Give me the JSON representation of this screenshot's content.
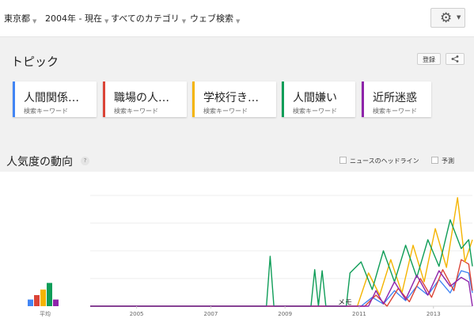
{
  "filters": [
    {
      "label": "東京都"
    },
    {
      "label": "2004年 - 現在"
    },
    {
      "label": "すべてのカテゴリ"
    },
    {
      "label": "ウェブ検索"
    }
  ],
  "icons": {
    "settings": "gear-icon",
    "share": "share-icon",
    "help": "help-icon"
  },
  "topics": {
    "title": "トピック",
    "register_label": "登録",
    "items": [
      {
        "term": "人間関係…",
        "type": "検索キーワード",
        "color": "#4285f4"
      },
      {
        "term": "職場の人…",
        "type": "検索キーワード",
        "color": "#db4437"
      },
      {
        "term": "学校行き…",
        "type": "検索キーワード",
        "color": "#f4b400"
      },
      {
        "term": "人間嫌い",
        "type": "検索キーワード",
        "color": "#0f9d58"
      },
      {
        "term": "近所迷惑",
        "type": "検索キーワード",
        "color": "#8e24aa"
      }
    ]
  },
  "interest": {
    "title": "人気度の動向",
    "news_headlines_label": "ニュースのヘッドライン",
    "forecast_label": "予測",
    "average_label": "平均",
    "memo_label": "メモ"
  },
  "chart_data": {
    "type": "line",
    "x_ticks": [
      "2005",
      "2007",
      "2009",
      "2011",
      "2013"
    ],
    "ylim": [
      0,
      100
    ],
    "averages": [
      {
        "name": "人間関係…",
        "value": 6
      },
      {
        "name": "職場の人…",
        "value": 10
      },
      {
        "name": "学校行き…",
        "value": 15
      },
      {
        "name": "人間嫌い",
        "value": 21
      },
      {
        "name": "近所迷惑",
        "value": 6
      }
    ],
    "series": [
      {
        "name": "人間関係…",
        "points": [
          [
            2004,
            0
          ],
          [
            2011.3,
            0
          ],
          [
            2011.6,
            8
          ],
          [
            2011.9,
            2
          ],
          [
            2012.2,
            14
          ],
          [
            2012.5,
            5
          ],
          [
            2012.8,
            18
          ],
          [
            2013.1,
            10
          ],
          [
            2013.4,
            24
          ],
          [
            2013.7,
            12
          ],
          [
            2014.0,
            32
          ],
          [
            2014.2,
            30
          ],
          [
            2014.3,
            12
          ]
        ]
      },
      {
        "name": "職場の人…",
        "points": [
          [
            2004,
            0
          ],
          [
            2011.4,
            0
          ],
          [
            2011.7,
            10
          ],
          [
            2012.0,
            0
          ],
          [
            2012.3,
            16
          ],
          [
            2012.6,
            4
          ],
          [
            2012.9,
            25
          ],
          [
            2013.2,
            8
          ],
          [
            2013.5,
            33
          ],
          [
            2013.8,
            14
          ],
          [
            2014.0,
            42
          ],
          [
            2014.2,
            38
          ],
          [
            2014.3,
            14
          ]
        ]
      },
      {
        "name": "学校行き…",
        "points": [
          [
            2004,
            0
          ],
          [
            2011.2,
            0
          ],
          [
            2011.5,
            30
          ],
          [
            2011.8,
            10
          ],
          [
            2012.1,
            42
          ],
          [
            2012.4,
            12
          ],
          [
            2012.7,
            55
          ],
          [
            2013.0,
            22
          ],
          [
            2013.3,
            70
          ],
          [
            2013.6,
            35
          ],
          [
            2013.9,
            98
          ],
          [
            2014.1,
            40
          ],
          [
            2014.3,
            60
          ]
        ]
      },
      {
        "name": "人間嫌い",
        "points": [
          [
            2004,
            0
          ],
          [
            2008.75,
            0
          ],
          [
            2008.85,
            45
          ],
          [
            2008.95,
            0
          ],
          [
            2009.95,
            0
          ],
          [
            2010.05,
            33
          ],
          [
            2010.15,
            0
          ],
          [
            2010.25,
            32
          ],
          [
            2010.35,
            0
          ],
          [
            2010.9,
            0
          ],
          [
            2011.0,
            30
          ],
          [
            2011.3,
            40
          ],
          [
            2011.6,
            15
          ],
          [
            2011.9,
            50
          ],
          [
            2012.2,
            22
          ],
          [
            2012.5,
            55
          ],
          [
            2012.8,
            26
          ],
          [
            2013.1,
            60
          ],
          [
            2013.4,
            36
          ],
          [
            2013.7,
            78
          ],
          [
            2014.0,
            52
          ],
          [
            2014.2,
            60
          ],
          [
            2014.3,
            36
          ]
        ]
      },
      {
        "name": "近所迷惑",
        "points": [
          [
            2004,
            0
          ],
          [
            2011.5,
            0
          ],
          [
            2011.7,
            14
          ],
          [
            2011.9,
            2
          ],
          [
            2012.2,
            22
          ],
          [
            2012.5,
            6
          ],
          [
            2012.8,
            28
          ],
          [
            2013.1,
            10
          ],
          [
            2013.4,
            32
          ],
          [
            2013.7,
            18
          ],
          [
            2014.0,
            26
          ],
          [
            2014.2,
            22
          ],
          [
            2014.3,
            0
          ]
        ]
      }
    ]
  }
}
